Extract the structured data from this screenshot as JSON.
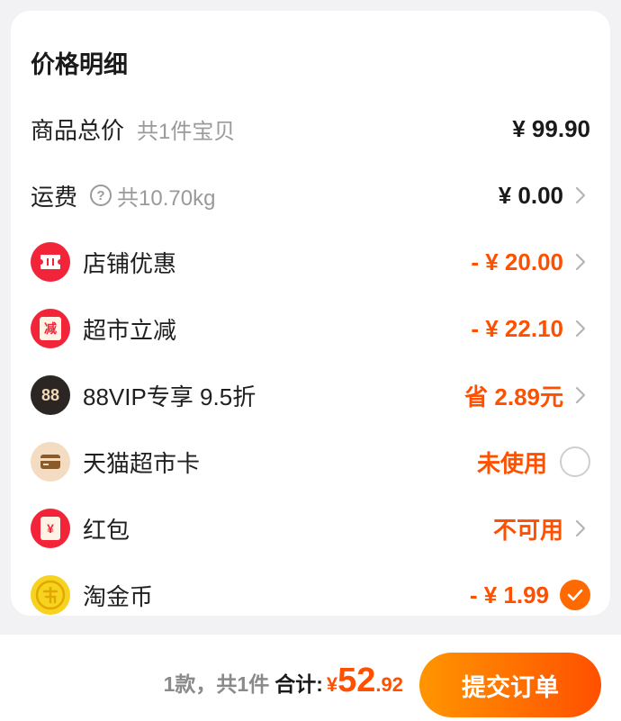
{
  "section_title": "价格明细",
  "rows": [
    {
      "label": "商品总价",
      "sub": "共1件宝贝",
      "value": "¥ 99.90"
    },
    {
      "label": "运费",
      "sub": "共10.70kg",
      "value": "¥ 0.00"
    },
    {
      "label": "店铺优惠",
      "value": "- ¥ 20.00"
    },
    {
      "label": "超市立减",
      "value": "- ¥ 22.10",
      "icon_text": "减"
    },
    {
      "label": "88VIP专享 9.5折",
      "value": "省 2.89元",
      "icon_text": "88"
    },
    {
      "label": "天猫超市卡",
      "value": "未使用"
    },
    {
      "label": "红包",
      "value": "不可用",
      "icon_text": "¥"
    },
    {
      "label": "淘金币",
      "value": "- ¥ 1.99",
      "checked": true
    }
  ],
  "footer": {
    "count_text": "1款，共1件",
    "total_label": "合计:",
    "currency": "¥",
    "total_integer": "52",
    "total_decimal": ".92",
    "submit_label": "提交订单"
  },
  "colors": {
    "accent": "#ff5000",
    "red_icon": "#f2243a",
    "coin": "#f7d31f"
  },
  "icons": [
    "question-mark-icon",
    "coupon-ticket-icon",
    "reduce-badge-icon",
    "vip-88-icon",
    "market-card-icon",
    "red-envelope-icon",
    "taobao-coin-icon",
    "chevron-right-icon",
    "checkmark-icon"
  ]
}
